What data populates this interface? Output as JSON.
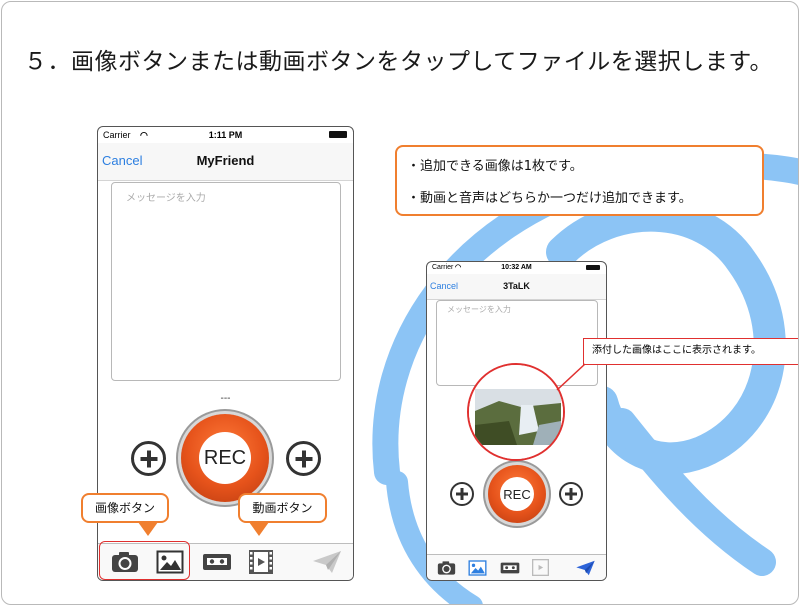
{
  "heading": "５．画像ボタンまたは動画ボタンをタップしてファイルを選択します。",
  "phone_big": {
    "carrier": "Carrier",
    "time": "1:11 PM",
    "cancel_label": "Cancel",
    "title": "MyFriend",
    "message_placeholder": "メッセージを入力",
    "dashes": "---",
    "rec_label": "REC"
  },
  "phone_small": {
    "carrier": "Carrier",
    "time": "10:32 AM",
    "cancel_label": "Cancel",
    "title": "3TaLK",
    "message_placeholder": "メッセージを入力",
    "dashes": "---",
    "rec_label": "REC"
  },
  "notes": {
    "line1": "・追加できる画像は1枚です。",
    "line2": "・動画と音声はどちらか一つだけ追加できます。"
  },
  "callouts": {
    "image_button": "画像ボタン",
    "video_button": "動画ボタン",
    "attached": "添付した画像はここに表示されます。"
  },
  "colors": {
    "accent_orange": "#f07f2f",
    "highlight_red": "#e0302f",
    "ios_blue": "#2d7fe0",
    "logo_blue": "#8cc4f5"
  },
  "icons": {
    "camera": "camera-icon",
    "image": "image-icon",
    "audio": "audio-tape-icon",
    "video": "film-icon",
    "send": "paper-plane-icon"
  }
}
